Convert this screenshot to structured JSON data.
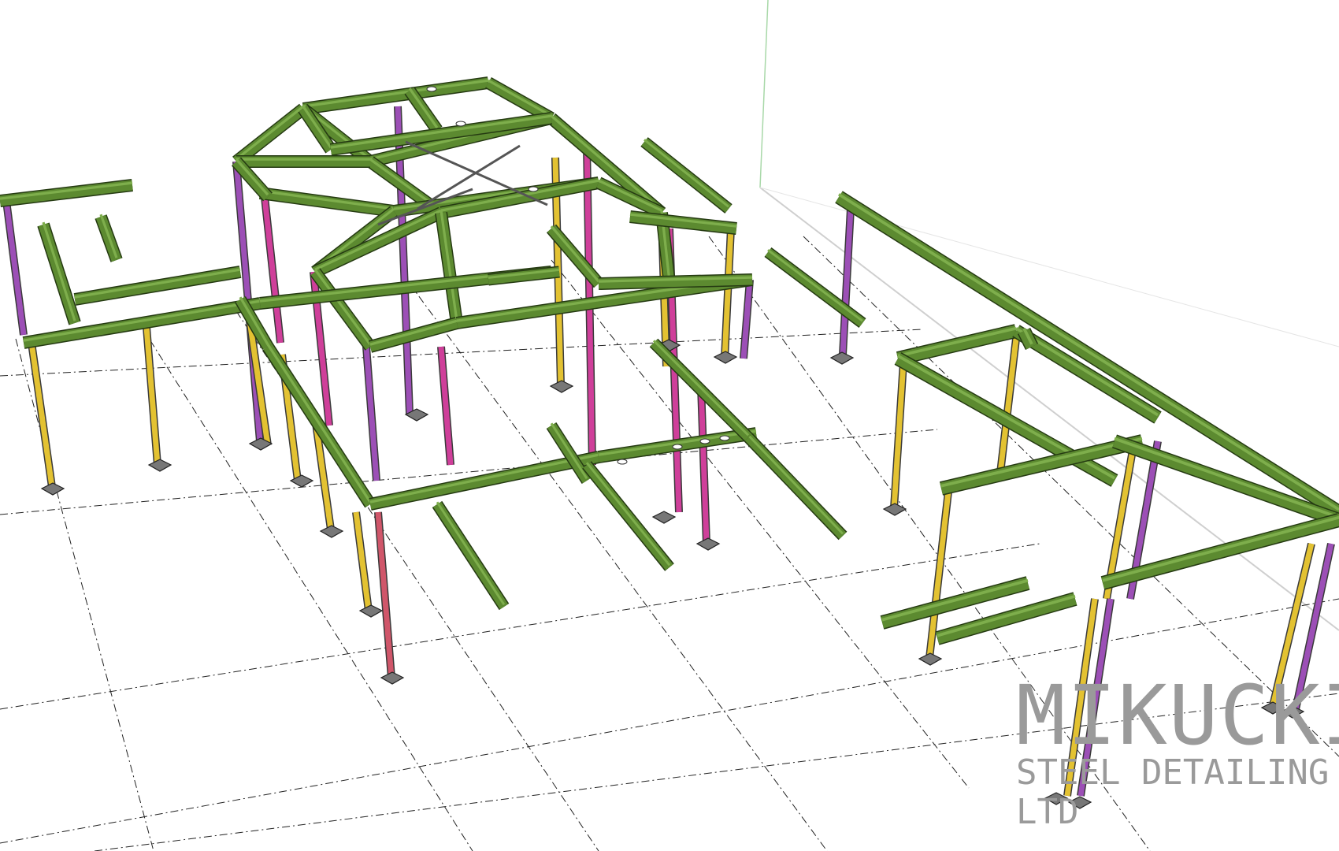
{
  "logo": {
    "name": "MIKUCKI",
    "subtitle": "STEEL DETAILING LTD"
  },
  "colors": {
    "beam": "#5c8a30",
    "beam_edge": "#253a12",
    "column_yellow": "#e3c232",
    "column_purple": "#9c4fb6",
    "column_magenta": "#cf3f9a",
    "column_red": "#d0566a",
    "base_plate": "#777777",
    "grid_line": "#222222",
    "axis_green": "#a8d8a8"
  }
}
